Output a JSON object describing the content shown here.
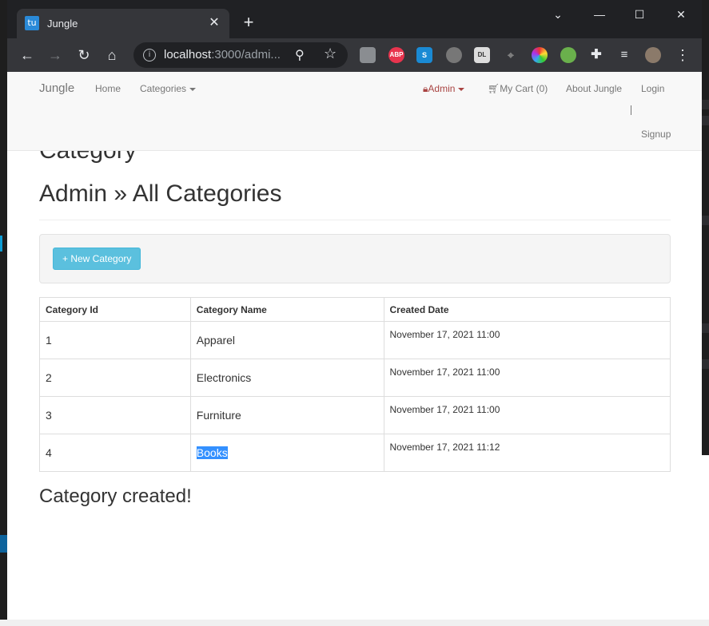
{
  "browser": {
    "tab_title": "Jungle",
    "tab_favicon_text": "tu",
    "url_host": "localhost",
    "url_rest": ":3000/admi...",
    "extensions": [
      "lightbulb-icon",
      "abp-icon",
      "s-icon",
      "circle-icon",
      "zoom-dl-icon",
      "mouse-icon",
      "color-wheel-icon",
      "frog-icon",
      "puzzle-icon",
      "media-icon",
      "profile-avatar"
    ]
  },
  "navbar": {
    "brand": "Jungle",
    "home": "Home",
    "categories": "Categories",
    "admin": "Admin",
    "cart": "My Cart (0)",
    "about": "About Jungle",
    "login": "Login",
    "signup": "Signup"
  },
  "page": {
    "partial_heading": "Category",
    "title": "Admin » All Categories",
    "new_button": "+ New Category",
    "flash": "Category created!"
  },
  "table": {
    "headers": [
      "Category Id",
      "Category Name",
      "Created Date"
    ],
    "rows": [
      {
        "id": "1",
        "name": "Apparel",
        "created": "November 17, 2021 11:00"
      },
      {
        "id": "2",
        "name": "Electronics",
        "created": "November 17, 2021 11:00"
      },
      {
        "id": "3",
        "name": "Furniture",
        "created": "November 17, 2021 11:00"
      },
      {
        "id": "4",
        "name": "Books",
        "created": "November 17, 2021 11:12"
      }
    ]
  },
  "colors": {
    "accent_button": "#5bc0de",
    "admin_red": "#a94442",
    "selection": "#3390ff"
  }
}
